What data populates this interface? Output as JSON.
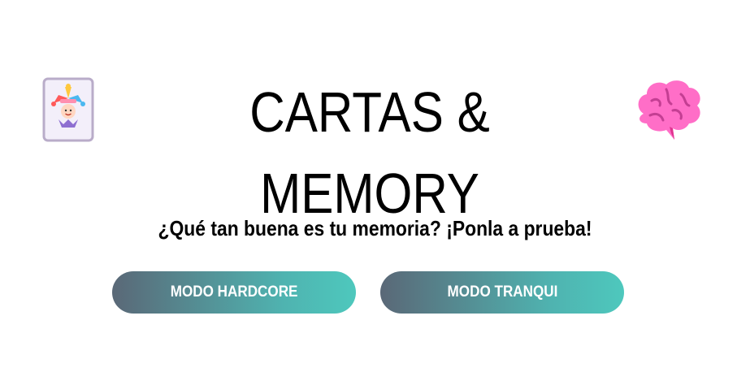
{
  "header": {
    "title": "CARTAS & MEMORY",
    "left_icon": "joker-card-icon",
    "right_icon": "brain-icon"
  },
  "subtitle": "¿Qué tan buena es tu memoria? ¡Ponla a prueba!",
  "buttons": {
    "hardcore_label": "MODO HARDCORE",
    "tranqui_label": "MODO TRANQUI"
  },
  "colors": {
    "button_gradient_start": "#5a6877",
    "button_gradient_end": "#4ec8bd",
    "brain": "#ff6ec7",
    "card_bg": "#f3effa",
    "card_border": "#b9acc9"
  }
}
